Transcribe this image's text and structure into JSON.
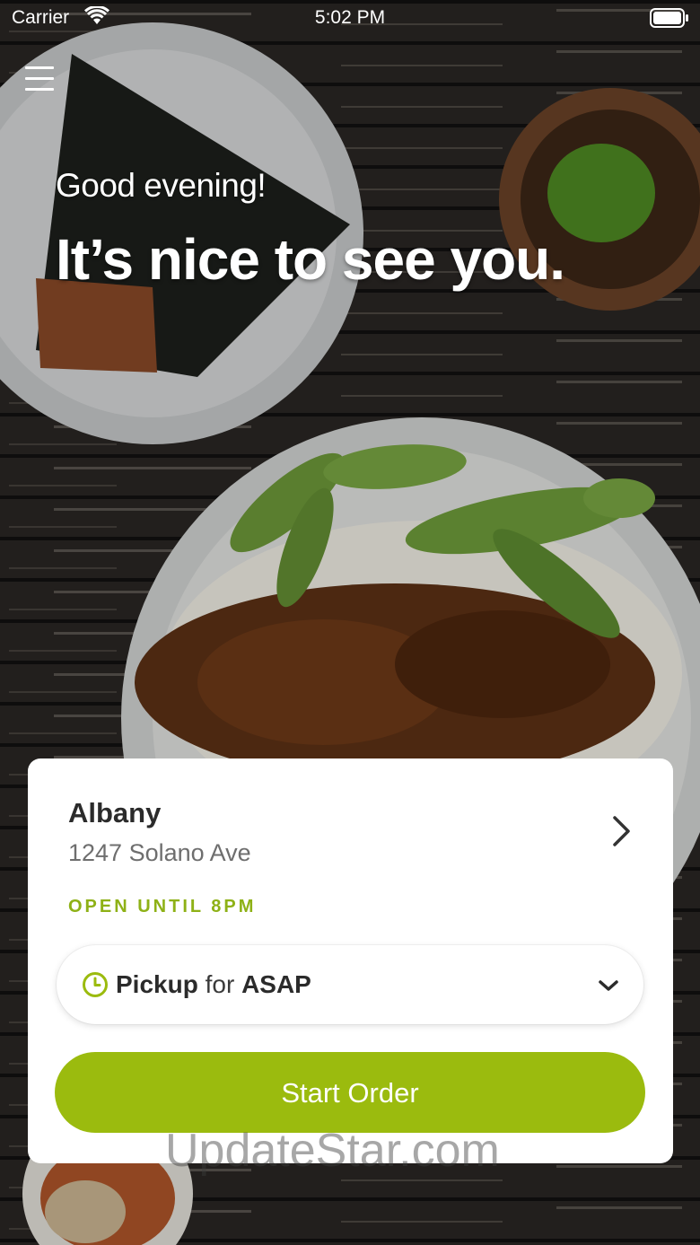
{
  "status_bar": {
    "carrier": "Carrier",
    "time": "5:02 PM"
  },
  "hero": {
    "greeting": "Good evening!",
    "headline": "It’s nice to see you."
  },
  "store": {
    "name": "Albany",
    "address": "1247 Solano Ave",
    "hours": "OPEN UNTIL 8PM"
  },
  "order_mode": {
    "mode": "Pickup",
    "connector": "for",
    "time": "ASAP"
  },
  "actions": {
    "start_order": "Start Order"
  },
  "watermark": "UpdateStar.com",
  "colors": {
    "accent": "#9bbb0e",
    "hours_text": "#8eb116",
    "card": "#ffffff"
  }
}
